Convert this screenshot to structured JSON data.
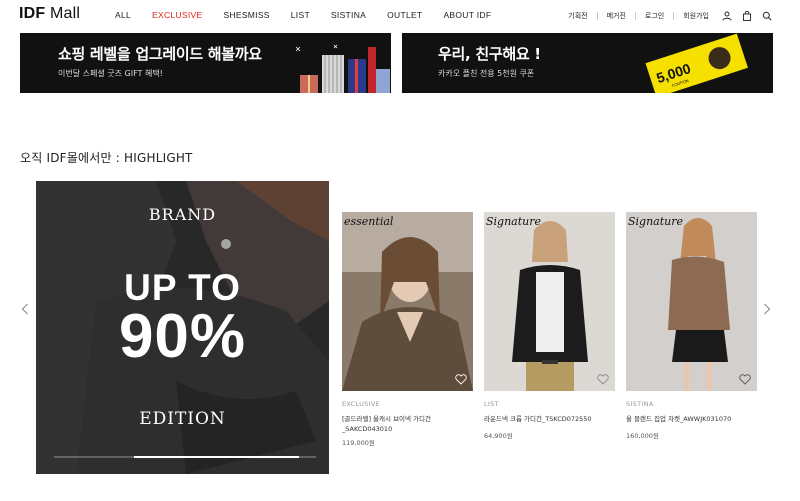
{
  "header": {
    "logo_bold": "IDF",
    "logo_rest": " Mall",
    "nav": [
      "ALL",
      "EXCLUSIVE",
      "SHESMISS",
      "LIST",
      "SISTINA",
      "OUTLET",
      "ABOUT IDF"
    ],
    "active_nav": "EXCLUSIVE",
    "util": [
      "기획전",
      "메거진",
      "로그인",
      "회원가입"
    ],
    "icons": [
      "user-icon",
      "bag-icon",
      "search-icon"
    ]
  },
  "banners": [
    {
      "title": "쇼핑 레벨을 업그레이드 해볼까요",
      "subtitle": "이번달 스페셜 굿즈 GIFT 혜택!"
    },
    {
      "title": "우리, 친구해요 !",
      "subtitle": "카카오 플친 전용 5천원 쿠폰",
      "coupon_amount": "5,000",
      "coupon_word": "COUPON"
    }
  ],
  "section_title": "오직 IDF몰에서만 : HIGHLIGHT",
  "hero": {
    "brand_top": "BRAND",
    "upto": "UP TO",
    "percent": "90%",
    "brand_bottom": "EDITION",
    "progress": 0.63
  },
  "products": [
    {
      "tag": "essential",
      "brand": "EXCLUSIVE",
      "name_line1": "[골드라벨] 울캐시 브이넥 가디건",
      "name_line2": "_SAKCD043010",
      "price": "119,000원",
      "img_bg": "#6e5e4f"
    },
    {
      "tag": "Signature",
      "brand": "LIST",
      "name_line1": "라운드넥 크롭 가디건_TSKCD072550",
      "name_line2": "",
      "price": "64,900원",
      "img_bg": "#d8d4cf"
    },
    {
      "tag": "Signature",
      "brand": "SISTINA",
      "name_line1": "울 블렌드 집업 자켓_AWWJK031070",
      "name_line2": "",
      "price": "160,000원",
      "img_bg": "#c9c6c3"
    }
  ],
  "colors": {
    "accent": "#e2231a",
    "banner_bg": "#111111",
    "coupon_yellow": "#f5e000"
  }
}
